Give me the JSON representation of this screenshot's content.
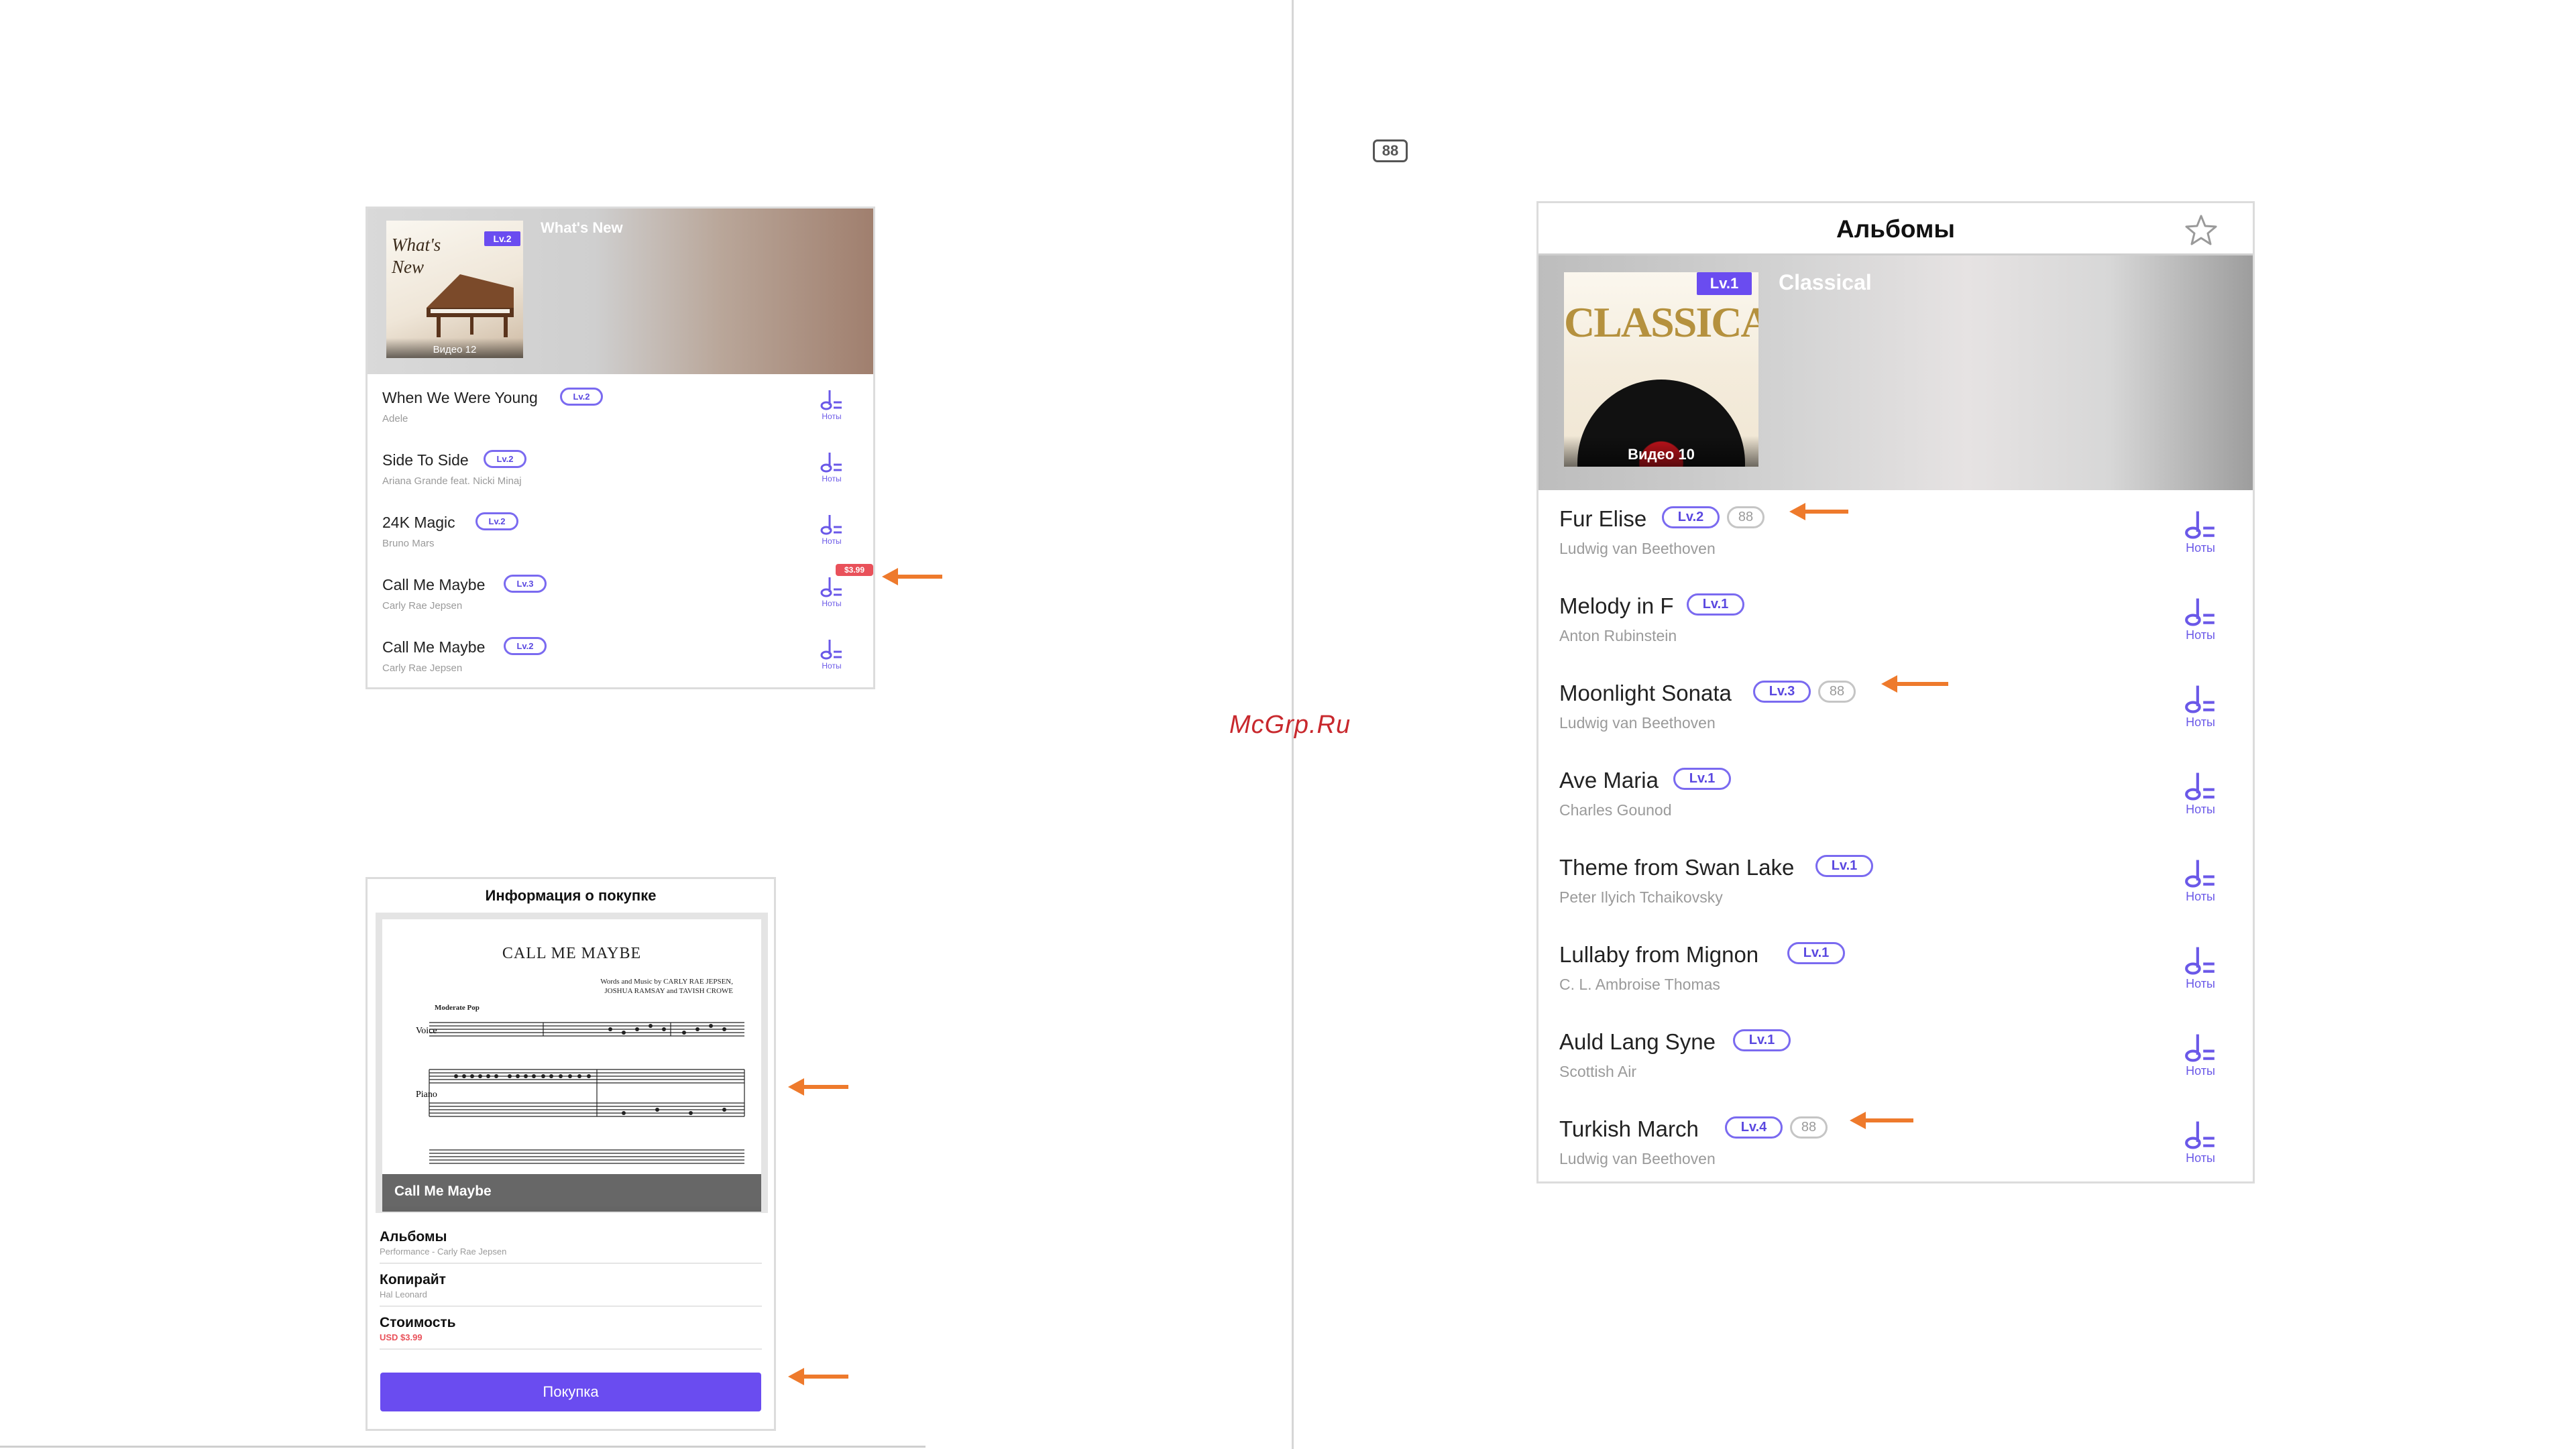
{
  "panel1": {
    "hero": {
      "title": "What's New",
      "badge": "Lv.2",
      "cover_text": "What's New",
      "video_label": "Видео 12"
    },
    "songs": [
      {
        "title": "When We Were Young",
        "level": "Lv.2",
        "artist": "Adele",
        "notes_label": "Ноты"
      },
      {
        "title": "Side To Side",
        "level": "Lv.2",
        "artist": "Ariana Grande feat. Nicki Minaj",
        "notes_label": "Ноты"
      },
      {
        "title": "24K Magic",
        "level": "Lv.2",
        "artist": "Bruno Mars",
        "notes_label": "Ноты"
      },
      {
        "title": "Call Me Maybe",
        "level": "Lv.3",
        "artist": "Carly Rae Jepsen",
        "notes_label": "Ноты",
        "price": "$3.99"
      },
      {
        "title": "Call Me Maybe",
        "level": "Lv.2",
        "artist": "Carly Rae Jepsen",
        "notes_label": "Ноты"
      }
    ]
  },
  "panel2": {
    "title": "Информация о покупке",
    "sheet_title": "CALL ME MAYBE",
    "sheet_credit_line1": "Words and Music by CARLY RAE JEPSEN,",
    "sheet_credit_line2": "JOSHUA RAMSAY and TAVISH CROWE",
    "sheet_tempo": "Moderate Pop",
    "sheet_caption": "Call Me Maybe",
    "info": [
      {
        "label": "Альбомы",
        "value": "Performance - Carly Rae Jepsen"
      },
      {
        "label": "Копирайт",
        "value": "Hal Leonard"
      },
      {
        "label": "Стоимость",
        "value": "USD $3.99"
      }
    ],
    "buy_label": "Покупка"
  },
  "keyboard_icon": "88",
  "watermark": "McGrp.Ru",
  "panel3": {
    "nav_title": "Альбомы",
    "hero": {
      "title": "Classical",
      "badge": "Lv.1",
      "cover_text": "CLASSICAL",
      "video_label": "Видео 10"
    },
    "songs": [
      {
        "title": "Fur Elise",
        "level": "Lv.2",
        "keys": "88",
        "artist": "Ludwig van Beethoven",
        "notes_label": "Ноты"
      },
      {
        "title": "Melody in F",
        "level": "Lv.1",
        "artist": "Anton Rubinstein",
        "notes_label": "Ноты"
      },
      {
        "title": "Moonlight Sonata",
        "level": "Lv.3",
        "keys": "88",
        "artist": "Ludwig van Beethoven",
        "notes_label": "Ноты"
      },
      {
        "title": "Ave Maria",
        "level": "Lv.1",
        "artist": "Charles Gounod",
        "notes_label": "Ноты"
      },
      {
        "title": "Theme from Swan Lake",
        "level": "Lv.1",
        "artist": "Peter Ilyich Tchaikovsky",
        "notes_label": "Ноты"
      },
      {
        "title": "Lullaby from Mignon",
        "level": "Lv.1",
        "artist": "C. L. Ambroise Thomas",
        "notes_label": "Ноты"
      },
      {
        "title": "Auld Lang Syne",
        "level": "Lv.1",
        "artist": "Scottish Air",
        "notes_label": "Ноты"
      },
      {
        "title": "Turkish March",
        "level": "Lv.4",
        "keys": "88",
        "artist": "Ludwig van Beethoven",
        "notes_label": "Ноты"
      }
    ]
  },
  "colors": {
    "accent": "#6a4cf0",
    "arrow": "#ee7a2c",
    "price": "#e9515a"
  }
}
